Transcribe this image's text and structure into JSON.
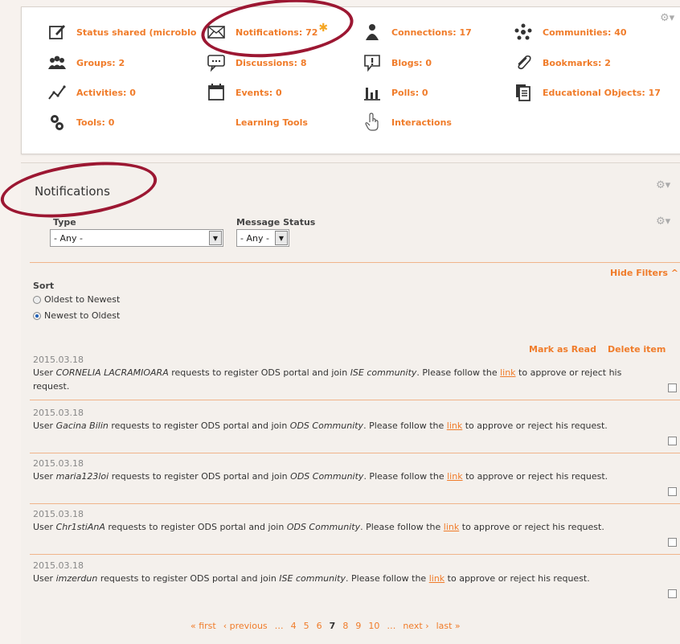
{
  "dashboard": {
    "items": [
      {
        "label": "Status shared (microblo",
        "icon": "edit-icon"
      },
      {
        "label": "Notifications: 72",
        "icon": "envelope-icon"
      },
      {
        "label": "Connections: 17",
        "icon": "person-icon"
      },
      {
        "label": "Communities: 40",
        "icon": "community-icon"
      },
      {
        "label": "Groups: 2",
        "icon": "group-icon"
      },
      {
        "label": "Discussions: 8",
        "icon": "speech-bubble-icon"
      },
      {
        "label": "Blogs: 0",
        "icon": "blog-icon"
      },
      {
        "label": "Bookmarks: 2",
        "icon": "paperclip-icon"
      },
      {
        "label": "Activities: 0",
        "icon": "activity-icon"
      },
      {
        "label": "Events: 0",
        "icon": "calendar-icon"
      },
      {
        "label": "Polls: 0",
        "icon": "poll-icon"
      },
      {
        "label": "Educational Objects: 17",
        "icon": "documents-icon"
      },
      {
        "label": "Tools: 0",
        "icon": "gears-icon"
      },
      {
        "label": "Learning Tools",
        "icon": ""
      },
      {
        "label": "Interactions",
        "icon": "hand-pointer-icon"
      }
    ],
    "new_marker": "✱"
  },
  "notifications": {
    "title": "Notifications",
    "filters": {
      "type_label": "Type",
      "type_value": "- Any -",
      "status_label": "Message Status",
      "status_value": "- Any -",
      "hide_filters": "Hide Filters"
    },
    "sort": {
      "label": "Sort",
      "options": [
        {
          "label": "Oldest to Newest",
          "checked": false
        },
        {
          "label": "Newest to Oldest",
          "checked": true
        }
      ]
    },
    "actions": {
      "mark_read": "Mark as Read",
      "delete": "Delete item"
    },
    "messages": [
      {
        "date": "2015.03.18",
        "user": "CORNELIA LACRAMIOARA",
        "community": "ISE community"
      },
      {
        "date": "2015.03.18",
        "user": "Gacina Bilin",
        "community": "ODS Community"
      },
      {
        "date": "2015.03.18",
        "user": "maria123loi",
        "community": "ODS Community"
      },
      {
        "date": "2015.03.18",
        "user": "Chr1stiAnA",
        "community": "ODS Community"
      },
      {
        "date": "2015.03.18",
        "user": "imzerdun",
        "community": "ISE community"
      }
    ],
    "message_text": {
      "prefix": "User ",
      "mid": " requests to register ODS portal and join ",
      "after_community": ". Please follow the ",
      "link": "link",
      "suffix": " to approve or reject his request."
    },
    "pager": {
      "first": "« first",
      "previous": "‹ previous",
      "ellipsis": "…",
      "pages": [
        "4",
        "5",
        "6",
        "7",
        "8",
        "9",
        "10"
      ],
      "current": "7",
      "next": "next ›",
      "last": "last »"
    }
  },
  "colors": {
    "accent": "#f07c2a",
    "highlight": "#9c1732"
  }
}
